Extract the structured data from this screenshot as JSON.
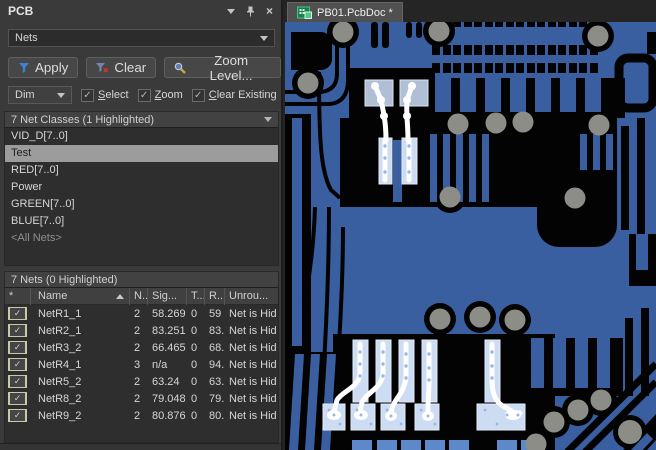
{
  "colors": {
    "panel_bg": "#3a3a3a",
    "panel_text": "#d6d6d6",
    "muted_text": "#8f8f8f",
    "field_bg": "#2c2c2c",
    "list_bg": "#2e2e2e",
    "border": "#5a5a5a",
    "dark_border": "#232323",
    "button_bg": "#474747",
    "header_bg": "#424242",
    "selected_bg": "#9c9c9c",
    "selected_text": "#1f1f1f",
    "check_khaki": "#c9c9a5",
    "tabbar_bg": "#252525",
    "tab_bg": "#505050",
    "tab_text": "#efefef",
    "apply_blue": "#3f7fd4",
    "clear_red": "#cc3333",
    "magnifier_gold": "#c9a44a",
    "doc_icon_green": "#35a06c",
    "copper": "#3a5fa0",
    "copper_light": "#5d88c9",
    "board_black": "#030303",
    "via_gray": "#8d8d87",
    "pad_light": "#cbdcf3",
    "pad_gray": "#aebfd6",
    "trace_white": "#ffffff",
    "dot_blue": "#9db6dc"
  },
  "panel": {
    "title": "PCB",
    "filter_type": {
      "value": "Nets"
    },
    "toolbar": {
      "apply": "Apply",
      "clear": "Clear",
      "zoom_level": "Zoom Level..."
    },
    "options": {
      "mask_mode": "Dim",
      "select": "Select",
      "zoom": "Zoom",
      "clear_existing": "Clear Existing",
      "check_glyph": "✓"
    },
    "net_classes": {
      "header": "7 Net Classes (1 Highlighted)",
      "items": [
        {
          "label": "VID_D[7..0]",
          "selected": false
        },
        {
          "label": "Test",
          "selected": true
        },
        {
          "label": "RED[7..0]",
          "selected": false
        },
        {
          "label": "Power",
          "selected": false
        },
        {
          "label": "GREEN[7..0]",
          "selected": false
        },
        {
          "label": "BLUE[7..0]",
          "selected": false
        },
        {
          "label": "<All Nets>",
          "selected": false,
          "muted": true
        }
      ]
    },
    "nets": {
      "header": "7 Nets (0 Highlighted)",
      "check_glyph": "✓",
      "columns": {
        "check": "*",
        "name": "Name",
        "nodes": "N..",
        "signal": "Sig...",
        "t": "T...",
        "routed": "R...",
        "unrouted": "Unrou..."
      },
      "rows": [
        {
          "checked": true,
          "name": "NetR1_1",
          "nodes": "2",
          "signal": "58.269",
          "t": "0",
          "routed": "59",
          "unrouted": "Net is Hid"
        },
        {
          "checked": true,
          "name": "NetR2_1",
          "nodes": "2",
          "signal": "83.251",
          "t": "0",
          "routed": "83.",
          "unrouted": "Net is Hid"
        },
        {
          "checked": true,
          "name": "NetR3_2",
          "nodes": "2",
          "signal": "66.465",
          "t": "0",
          "routed": "68.",
          "unrouted": "Net is Hid"
        },
        {
          "checked": true,
          "name": "NetR4_1",
          "nodes": "3",
          "signal": "n/a",
          "t": "0",
          "routed": "94.",
          "unrouted": "Net is Hid"
        },
        {
          "checked": true,
          "name": "NetR5_2",
          "nodes": "2",
          "signal": "63.24",
          "t": "0",
          "routed": "63.",
          "unrouted": "Net is Hid"
        },
        {
          "checked": true,
          "name": "NetR8_2",
          "nodes": "2",
          "signal": "79.048",
          "t": "0",
          "routed": "79.",
          "unrouted": "Net is Hid"
        },
        {
          "checked": true,
          "name": "NetR9_2",
          "nodes": "2",
          "signal": "80.876",
          "t": "0",
          "routed": "80.",
          "unrouted": "Net is Hid"
        }
      ]
    }
  },
  "editor": {
    "tab": {
      "label": "PB01.PcbDoc *"
    }
  }
}
